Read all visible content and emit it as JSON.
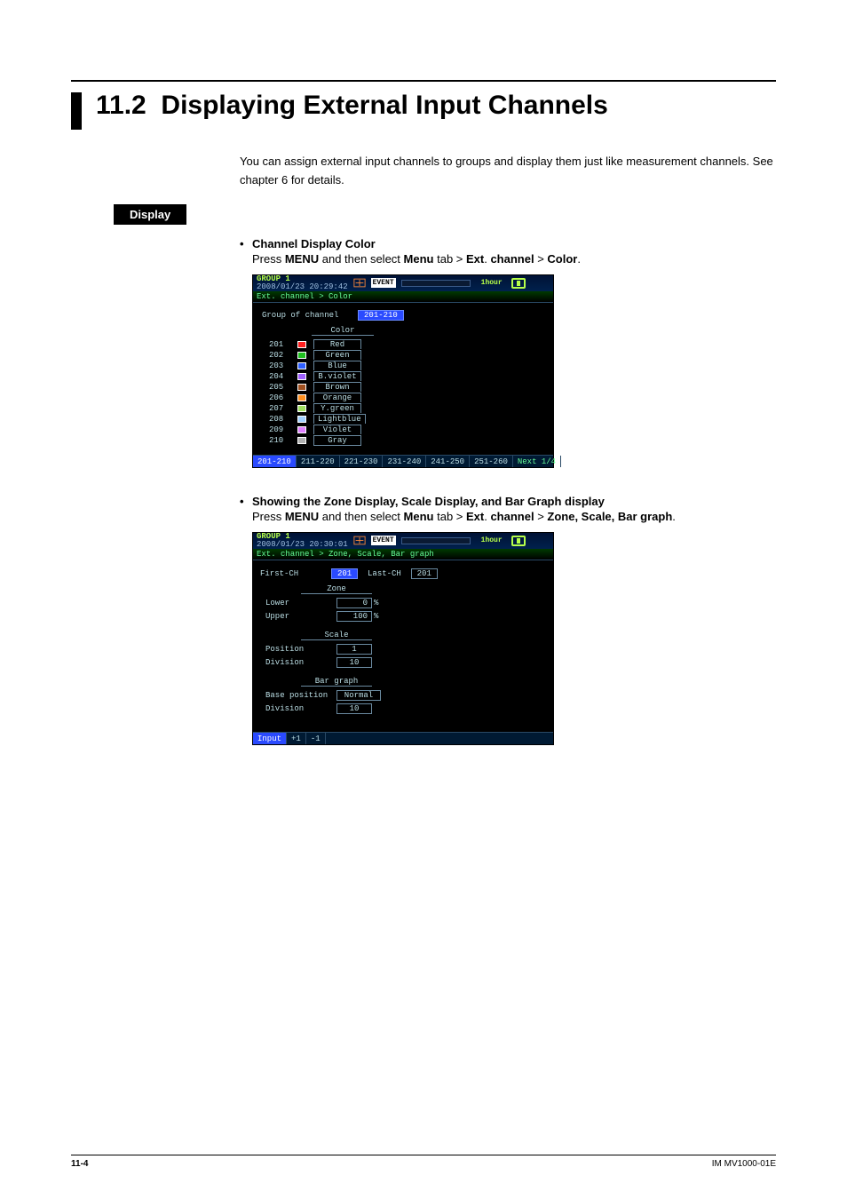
{
  "section": {
    "number": "11.2",
    "title": "Displaying External Input Channels"
  },
  "intro": "You can assign external input channels to groups and display them just like measurement channels. See chapter 6 for details.",
  "display_label": "Display",
  "block1": {
    "heading": "Channel Display Color",
    "press": "Press ",
    "menu1": "MENU",
    "mid1": " and then select ",
    "menu2": "Menu",
    "mid2": " tab > ",
    "ext": "Ext",
    "dot": ". ",
    "channel": "channel",
    "gt": " > ",
    "last": "Color",
    "period": "."
  },
  "block2": {
    "heading": "Showing the Zone Display, Scale Display, and Bar Graph display",
    "press": "Press ",
    "menu1": "MENU",
    "mid1": " and then select ",
    "menu2": "Menu",
    "mid2": " tab > ",
    "ext": "Ext",
    "dot": ". ",
    "channel": "channel",
    "gt": " > ",
    "last": "Zone, Scale, Bar graph",
    "period": "."
  },
  "shot1": {
    "group": "GROUP 1",
    "timestamp": "2008/01/23 20:29:42",
    "event": "EVENT",
    "hour": "1hour",
    "crumb": "Ext. channel > Color",
    "goc_label": "Group of channel",
    "goc_value": "201-210",
    "panel_title": "Color",
    "rows": [
      {
        "ch": "201",
        "color": "#ff2020",
        "name": "Red"
      },
      {
        "ch": "202",
        "color": "#20c020",
        "name": "Green"
      },
      {
        "ch": "203",
        "color": "#3060ff",
        "name": "Blue"
      },
      {
        "ch": "204",
        "color": "#a060ff",
        "name": "B.violet"
      },
      {
        "ch": "205",
        "color": "#a05020",
        "name": "Brown"
      },
      {
        "ch": "206",
        "color": "#ff9020",
        "name": "Orange"
      },
      {
        "ch": "207",
        "color": "#a0e060",
        "name": "Y.green"
      },
      {
        "ch": "208",
        "color": "#a0d0ff",
        "name": "Lightblue"
      },
      {
        "ch": "209",
        "color": "#e080ff",
        "name": "Violet"
      },
      {
        "ch": "210",
        "color": "#b0b0b0",
        "name": "Gray"
      }
    ],
    "tabs": [
      "201-210",
      "211-220",
      "221-230",
      "231-240",
      "241-250",
      "251-260",
      "Next 1/4"
    ]
  },
  "shot2": {
    "group": "GROUP 1",
    "timestamp": "2008/01/23 20:30:01",
    "event": "EVENT",
    "hour": "1hour",
    "crumb": "Ext. channel > Zone, Scale, Bar graph",
    "first_label": "First-CH",
    "first_val": "201",
    "last_label": "Last-CH",
    "last_val": "201",
    "zone": {
      "title": "Zone",
      "lower_l": "Lower",
      "lower_v": "0",
      "upper_l": "Upper",
      "upper_v": "100",
      "unit": "%"
    },
    "scale": {
      "title": "Scale",
      "pos_l": "Position",
      "pos_v": "1",
      "div_l": "Division",
      "div_v": "10"
    },
    "bar": {
      "title": "Bar graph",
      "bp_l": "Base position",
      "bp_v": "Normal",
      "div_l": "Division",
      "div_v": "10"
    },
    "tabs": [
      "Input",
      "+1",
      "-1"
    ]
  },
  "footer": {
    "page": "11-4",
    "doc": "IM MV1000-01E"
  }
}
